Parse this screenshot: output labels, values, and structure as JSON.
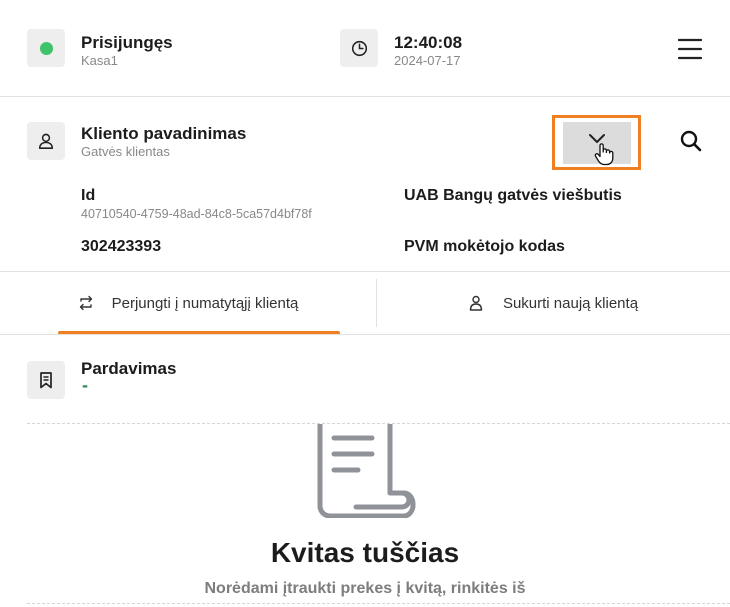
{
  "status": {
    "label": "Prisijungęs",
    "register": "Kasa1",
    "color": "#3ec26a"
  },
  "clock": {
    "time": "12:40:08",
    "date": "2024-07-17"
  },
  "client": {
    "name_label": "Kliento pavadinimas",
    "name_value": "Gatvės klientas",
    "id_label": "Id",
    "id_value": "40710540-4759-48ad-84c8-5ca57d4bf78f",
    "company": "UAB Bangų gatvės viešbutis",
    "code": "302423393",
    "vat_label": "PVM mokėtojo kodas"
  },
  "tabs": [
    {
      "label": "Perjungti į numatytąjį klientą",
      "icon": "switch-arrows-icon",
      "active": true
    },
    {
      "label": "Sukurti naują klientą",
      "icon": "add-user-icon",
      "active": false
    }
  ],
  "sale": {
    "label": "Pardavimas",
    "value": "-"
  },
  "empty": {
    "title": "Kvitas tuščias",
    "subtitle": "Norėdami įtraukti prekes į kvitą, rinkitės iš"
  },
  "colors": {
    "accent": "#f07f22",
    "status_green": "#3ec26a"
  }
}
